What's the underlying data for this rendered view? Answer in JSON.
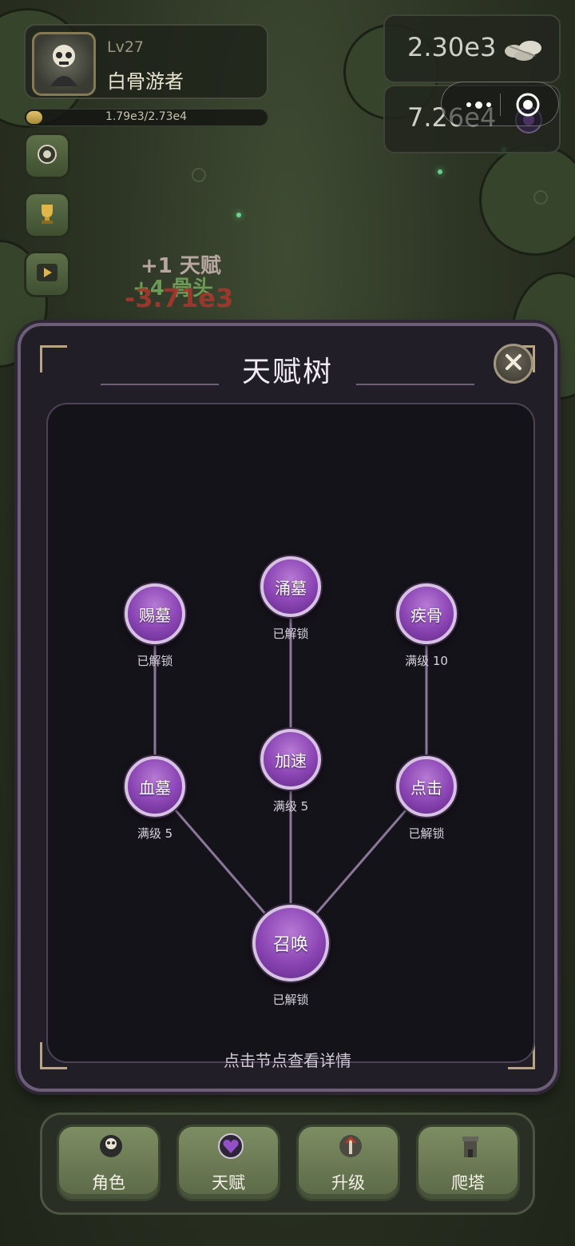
{
  "player": {
    "level": "Lv27",
    "name": "白骨游者",
    "xp_text": "1.79e3/2.73e4",
    "xp_progress": 0.0656,
    "avatar_icon": "skeleton-avatar-icon"
  },
  "currency": {
    "bones": "2.30e3",
    "bones_icon": "bone-pile-icon",
    "souls": "7.26e4",
    "souls_icon": "soul-gem-icon"
  },
  "side_buttons": [
    {
      "icon": "camera-icon"
    },
    {
      "icon": "trophy-icon"
    },
    {
      "icon": "video-icon"
    }
  ],
  "floating_texts": {
    "talent_gain": "+1 天赋",
    "bone_gain": "+4 骨头",
    "damage": "-3.71e3"
  },
  "dialog": {
    "title": "天赋树",
    "close_icon": "close-icon",
    "hint": "点击节点查看详情"
  },
  "talents": {
    "cimu": {
      "label": "赐墓",
      "status": "已解锁"
    },
    "yongmu": {
      "label": "涌墓",
      "status": "已解锁"
    },
    "jigu": {
      "label": "疾骨",
      "status": "满级 10"
    },
    "xuemu": {
      "label": "血墓",
      "status": "满级 5"
    },
    "jiasu": {
      "label": "加速",
      "status": "满级 5"
    },
    "dianji": {
      "label": "点击",
      "status": "已解锁"
    },
    "zhaohuan": {
      "label": "召唤",
      "status": "已解锁"
    }
  },
  "nav": [
    {
      "label": "角色",
      "icon": "character-icon"
    },
    {
      "label": "天赋",
      "icon": "talent-heart-icon"
    },
    {
      "label": "升级",
      "icon": "upgrade-shield-icon"
    },
    {
      "label": "爬塔",
      "icon": "tower-icon"
    }
  ],
  "colors": {
    "node_purple": "#8a44b3",
    "dialog_bg": "#221e27",
    "nav_green": "#6f7d57"
  }
}
